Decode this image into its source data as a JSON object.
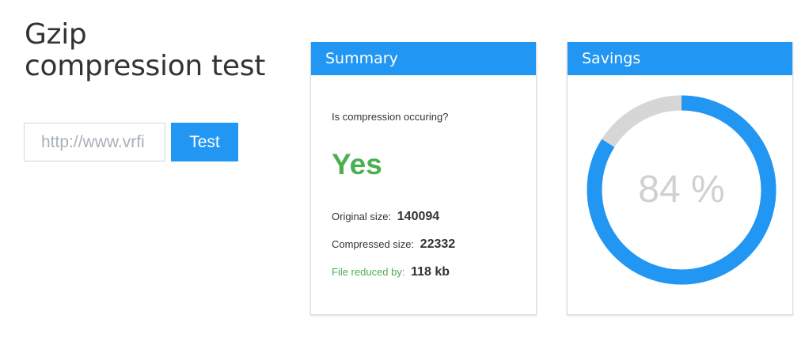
{
  "header": {
    "title_line1": "Gzip",
    "title_line2": "compression test"
  },
  "form": {
    "url_placeholder": "http://www.vrfi",
    "test_label": "Test"
  },
  "summary": {
    "header": "Summary",
    "question": "Is compression occuring?",
    "answer": "Yes",
    "original_label": "Original size:",
    "original_value": "140094",
    "compressed_label": "Compressed size:",
    "compressed_value": "22332",
    "reduced_label": "File reduced by:",
    "reduced_value": "118 kb"
  },
  "savings": {
    "header": "Savings",
    "percent_text": "84 %",
    "percent": 84
  },
  "colors": {
    "accent": "#2196f3",
    "success": "#4caf50",
    "track": "#d6d6d6"
  }
}
